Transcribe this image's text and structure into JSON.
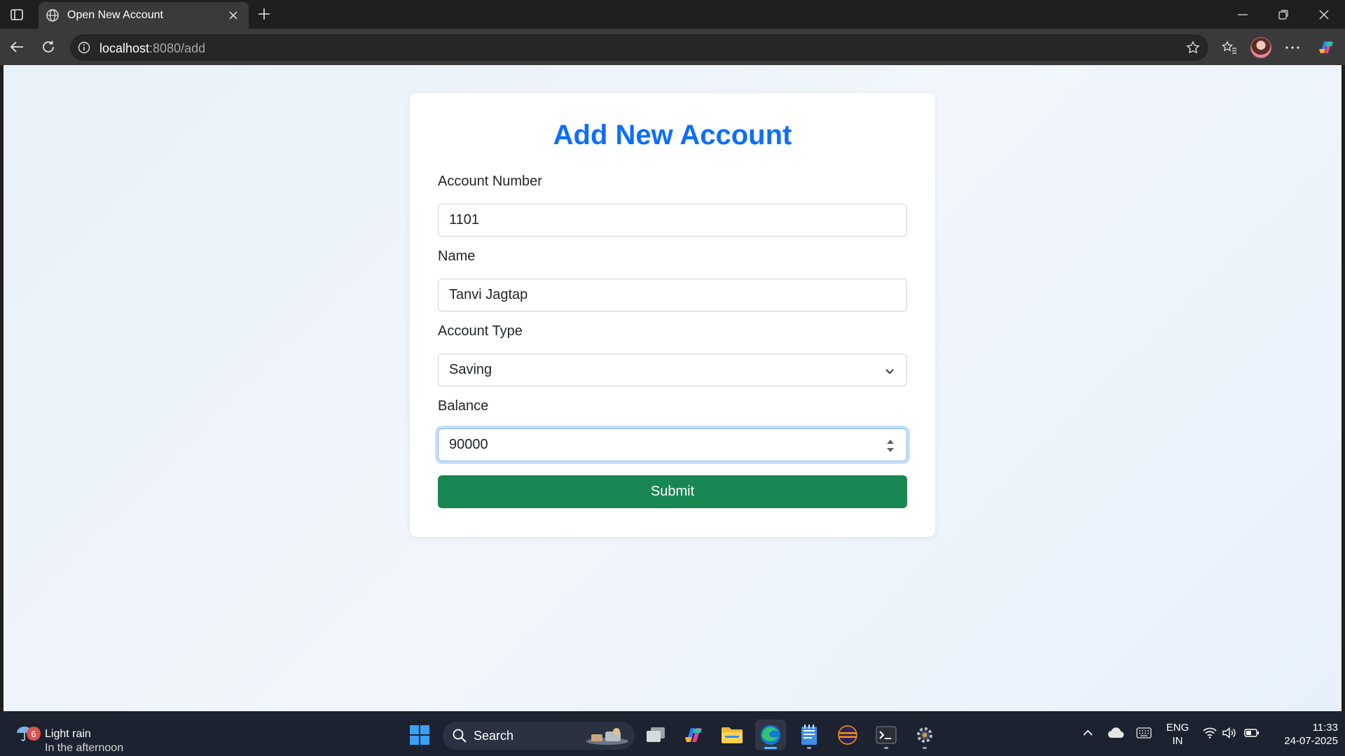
{
  "browser": {
    "tab_title": "Open New Account",
    "url_host": "localhost",
    "url_rest": ":8080/add"
  },
  "page": {
    "heading": "Add New Account",
    "account_number": {
      "label": "Account Number",
      "value": "1101"
    },
    "name": {
      "label": "Name",
      "value": "Tanvi Jagtap"
    },
    "account_type": {
      "label": "Account Type",
      "value": "Saving"
    },
    "balance": {
      "label": "Balance",
      "value": "90000"
    },
    "submit_label": "Submit"
  },
  "taskbar": {
    "weather": {
      "badge": "6",
      "line1": "Light rain",
      "line2": "In the afternoon"
    },
    "search_label": "Search",
    "lang_line1": "ENG",
    "lang_line2": "IN",
    "time": "11:33",
    "date": "24-07-2025"
  },
  "colors": {
    "heading": "#0d6efd",
    "submit": "#198754",
    "focus_ring": "#86b7fe"
  }
}
